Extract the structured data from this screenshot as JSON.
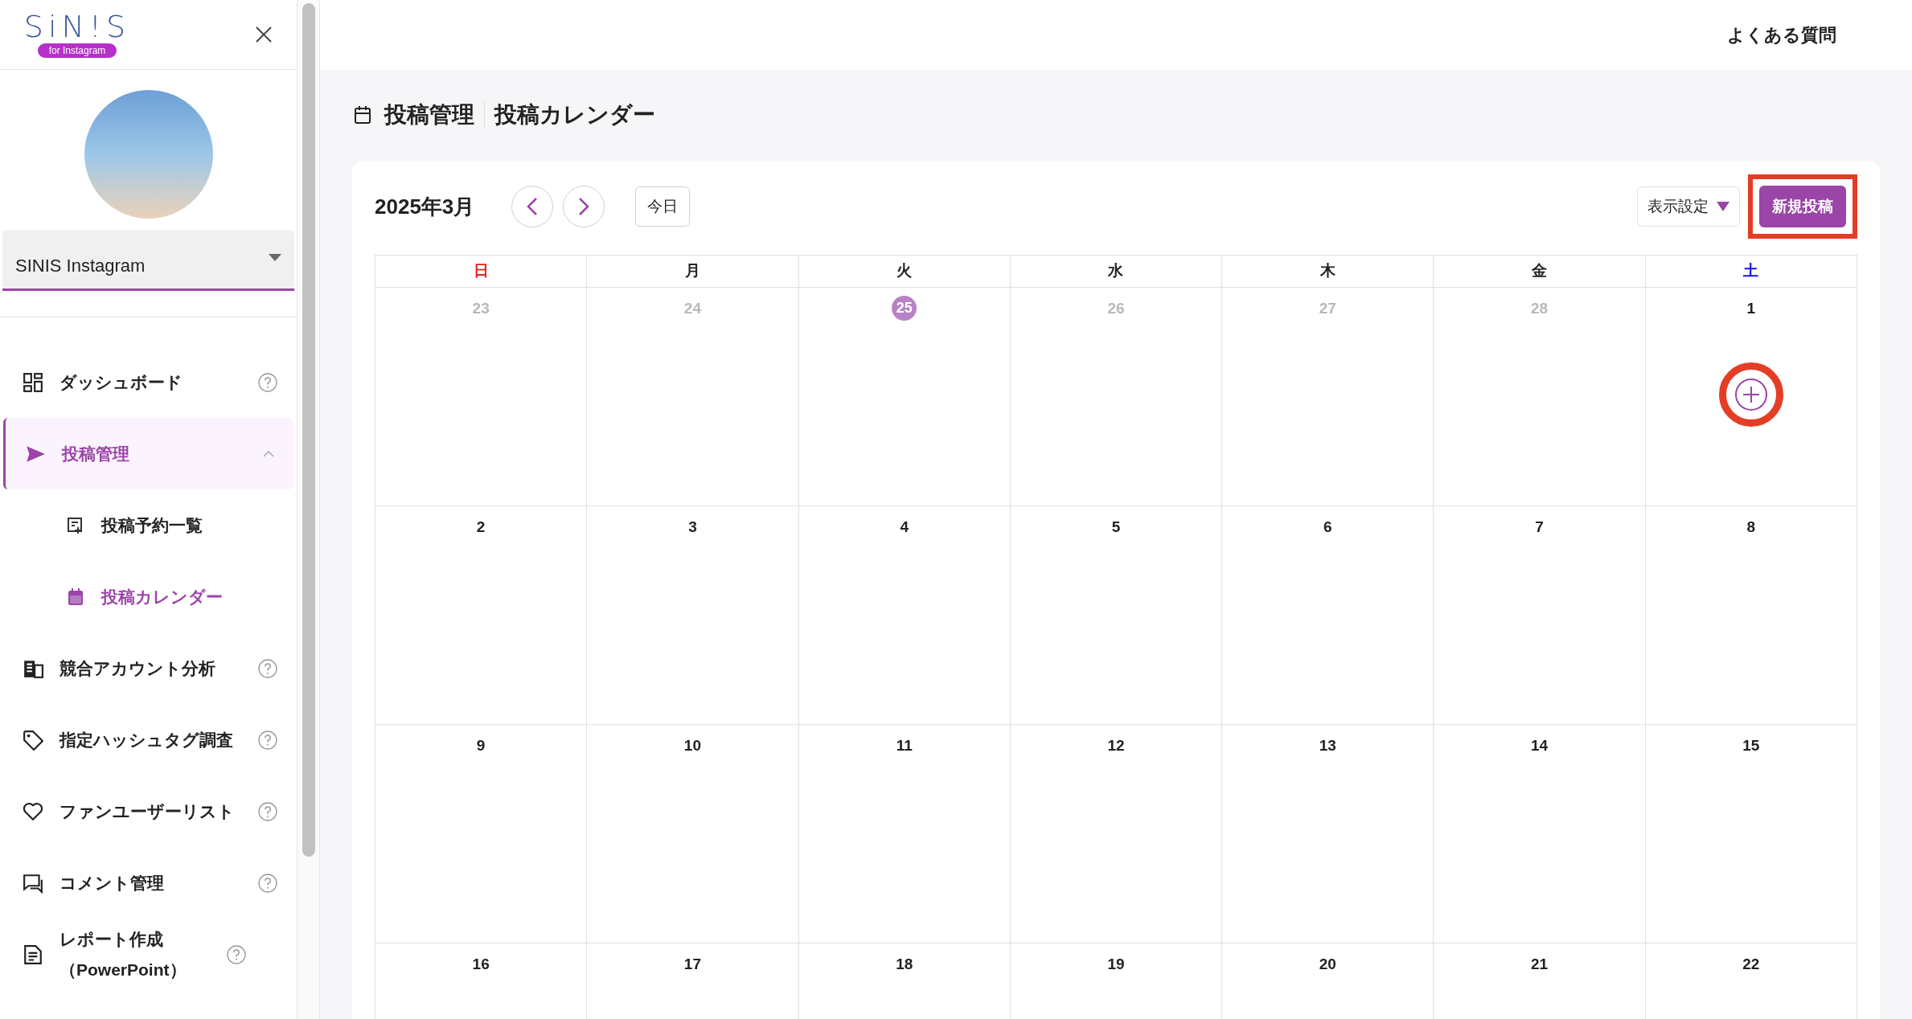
{
  "logo": {
    "title": "SiN!S",
    "subtitle": "for Instagram"
  },
  "account": {
    "name": "SINIS Instagram"
  },
  "nav": [
    {
      "label": "ダッシュボード",
      "kind": "dashboard",
      "help": true,
      "selected": false
    },
    {
      "label": "投稿管理",
      "kind": "send",
      "help": false,
      "selected": true,
      "expanded": true,
      "children": [
        {
          "label": "投稿予約一覧",
          "kind": "list",
          "selected": false
        },
        {
          "label": "投稿カレンダー",
          "kind": "calendar",
          "selected": true
        }
      ]
    },
    {
      "label": "競合アカウント分析",
      "kind": "building",
      "help": true,
      "selected": false
    },
    {
      "label": "指定ハッシュタグ調査",
      "kind": "tag",
      "help": true,
      "selected": false
    },
    {
      "label": "ファンユーザーリスト",
      "kind": "heart",
      "help": true,
      "selected": false
    },
    {
      "label": "コメント管理",
      "kind": "comment",
      "help": true,
      "selected": false
    },
    {
      "label": "レポート作成（PowerPoint）",
      "kind": "document",
      "help": true,
      "selected": false
    }
  ],
  "header": {
    "faq": "よくある質問"
  },
  "breadcrumb": [
    "投稿管理",
    "投稿カレンダー"
  ],
  "calendar": {
    "month": "2025年3月",
    "today_button": "今日",
    "view_settings": "表示設定",
    "new_post_button": {
      "label": "新規投稿",
      "highlighted": true
    },
    "weekdays": [
      {
        "label": "日",
        "color": "#e8201a"
      },
      {
        "label": "月",
        "color": "#222222"
      },
      {
        "label": "火",
        "color": "#222222"
      },
      {
        "label": "水",
        "color": "#222222"
      },
      {
        "label": "木",
        "color": "#222222"
      },
      {
        "label": "金",
        "color": "#222222"
      },
      {
        "label": "土",
        "color": "#1010ee"
      }
    ],
    "weeks": [
      [
        {
          "date": "23",
          "muted": true,
          "today": false
        },
        {
          "date": "24",
          "muted": true,
          "today": false
        },
        {
          "date": "25",
          "muted": true,
          "today": true
        },
        {
          "date": "26",
          "muted": true,
          "today": false
        },
        {
          "date": "27",
          "muted": true,
          "today": false
        },
        {
          "date": "28",
          "muted": true,
          "today": false
        },
        {
          "date": "1",
          "muted": false,
          "today": false,
          "add_button": true,
          "highlighted": true
        }
      ],
      [
        {
          "date": "2",
          "muted": false,
          "today": false
        },
        {
          "date": "3",
          "muted": false,
          "today": false
        },
        {
          "date": "4",
          "muted": false,
          "today": false
        },
        {
          "date": "5",
          "muted": false,
          "today": false
        },
        {
          "date": "6",
          "muted": false,
          "today": false
        },
        {
          "date": "7",
          "muted": false,
          "today": false
        },
        {
          "date": "8",
          "muted": false,
          "today": false
        }
      ],
      [
        {
          "date": "9",
          "muted": false,
          "today": false
        },
        {
          "date": "10",
          "muted": false,
          "today": false
        },
        {
          "date": "11",
          "muted": false,
          "today": false
        },
        {
          "date": "12",
          "muted": false,
          "today": false
        },
        {
          "date": "13",
          "muted": false,
          "today": false
        },
        {
          "date": "14",
          "muted": false,
          "today": false
        },
        {
          "date": "15",
          "muted": false,
          "today": false
        }
      ],
      [
        {
          "date": "16",
          "muted": false,
          "today": false
        },
        {
          "date": "17",
          "muted": false,
          "today": false
        },
        {
          "date": "18",
          "muted": false,
          "today": false
        },
        {
          "date": "19",
          "muted": false,
          "today": false
        },
        {
          "date": "20",
          "muted": false,
          "today": false
        },
        {
          "date": "21",
          "muted": false,
          "today": false
        },
        {
          "date": "22",
          "muted": false,
          "today": false
        }
      ]
    ]
  }
}
